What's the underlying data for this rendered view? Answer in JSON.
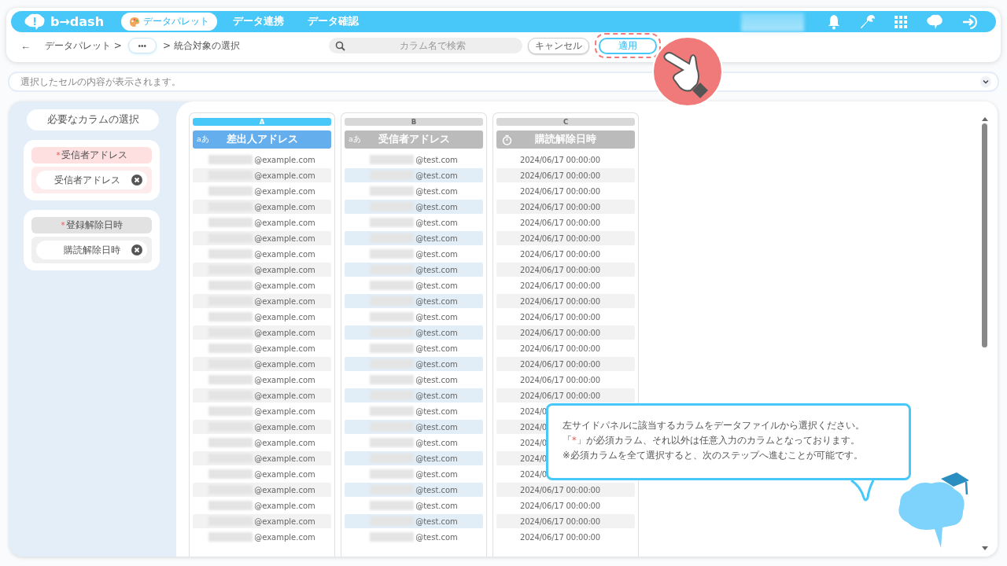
{
  "header": {
    "logo": "b→dash",
    "nav": [
      {
        "label": "データパレット",
        "selected": true
      },
      {
        "label": "データ連携",
        "selected": false
      },
      {
        "label": "データ確認",
        "selected": false
      }
    ]
  },
  "toolbar": {
    "back": "←",
    "breadcrumb": [
      {
        "label": "データパレット >",
        "kind": "link"
      },
      {
        "label": "•••",
        "kind": "more"
      },
      {
        "label": "> 統合対象の選択",
        "kind": "current"
      }
    ],
    "search": {
      "placeholder": "カラム名で検索"
    },
    "buttons": [
      {
        "label": "キャンセル",
        "kind": "secondary",
        "highlighted": false
      },
      {
        "label": "適用",
        "kind": "primary",
        "highlighted": true
      }
    ]
  },
  "cell_preview": {
    "placeholder": "選択したセルの内容が表示されます。"
  },
  "sidebar": {
    "title": "必要なカラムの選択",
    "fields": [
      {
        "mark": "*",
        "label": "受信者アドレス",
        "value": "受信者アドレス",
        "selected": true
      },
      {
        "mark": "*",
        "label": "登録解除日時",
        "value": "購読解除日時",
        "selected": false
      }
    ]
  },
  "columns": [
    {
      "letter": "A",
      "kind": "text",
      "type_label": "aあ",
      "title": "差出人アドレス",
      "selected": true,
      "mapped": false,
      "redacted": true,
      "cells": [
        "@example.com",
        "@example.com",
        "@example.com",
        "@example.com",
        "@example.com",
        "@example.com",
        "@example.com",
        "@example.com",
        "@example.com",
        "@example.com",
        "@example.com",
        "@example.com",
        "@example.com",
        "@example.com",
        "@example.com",
        "@example.com",
        "@example.com",
        "@example.com",
        "@example.com",
        "@example.com",
        "@example.com",
        "@example.com",
        "@example.com",
        "@example.com",
        "@example.com"
      ]
    },
    {
      "letter": "B",
      "kind": "text",
      "type_label": "aあ",
      "title": "受信者アドレス",
      "selected": false,
      "mapped": true,
      "redacted": true,
      "cells": [
        "@test.com",
        "@test.com",
        "@test.com",
        "@test.com",
        "@test.com",
        "@test.com",
        "@test.com",
        "@test.com",
        "@test.com",
        "@test.com",
        "@test.com",
        "@test.com",
        "@test.com",
        "@test.com",
        "@test.com",
        "@test.com",
        "@test.com",
        "@test.com",
        "@test.com",
        "@test.com",
        "@test.com",
        "@test.com",
        "@test.com",
        "@test.com",
        "@test.com"
      ]
    },
    {
      "letter": "C",
      "kind": "datetime",
      "title": "購読解除日時",
      "selected": false,
      "mapped": false,
      "redacted": false,
      "cells": [
        "2024/06/17 00:00:00",
        "2024/06/17 00:00:00",
        "2024/06/17 00:00:00",
        "2024/06/17 00:00:00",
        "2024/06/17 00:00:00",
        "2024/06/17 00:00:00",
        "2024/06/17 00:00:00",
        "2024/06/17 00:00:00",
        "2024/06/17 00:00:00",
        "2024/06/17 00:00:00",
        "2024/06/17 00:00:00",
        "2024/06/17 00:00:00",
        "2024/06/17 00:00:00",
        "2024/06/17 00:00:00",
        "2024/06/17 00:00:00",
        "2024/06/17 00:00:00",
        "2024/0",
        "2024/0",
        "2024/0",
        "2024/0",
        "2024/0",
        "2024/06/17 00:00:00",
        "2024/06/17 00:00:00",
        "2024/06/17 00:00:00",
        "2024/06/17 00:00:00"
      ]
    }
  ],
  "tooltip": {
    "line1": "左サイドパネルに該当するカラムをデータファイルから選択ください。",
    "line2_before": "「",
    "line2_mark": "*",
    "line2_after": "」が必須カラム、それ以外は任意入力のカラムとなっております。",
    "note": "※必須カラムを全て選択すると、次のステップへ進むことが可能です。"
  }
}
